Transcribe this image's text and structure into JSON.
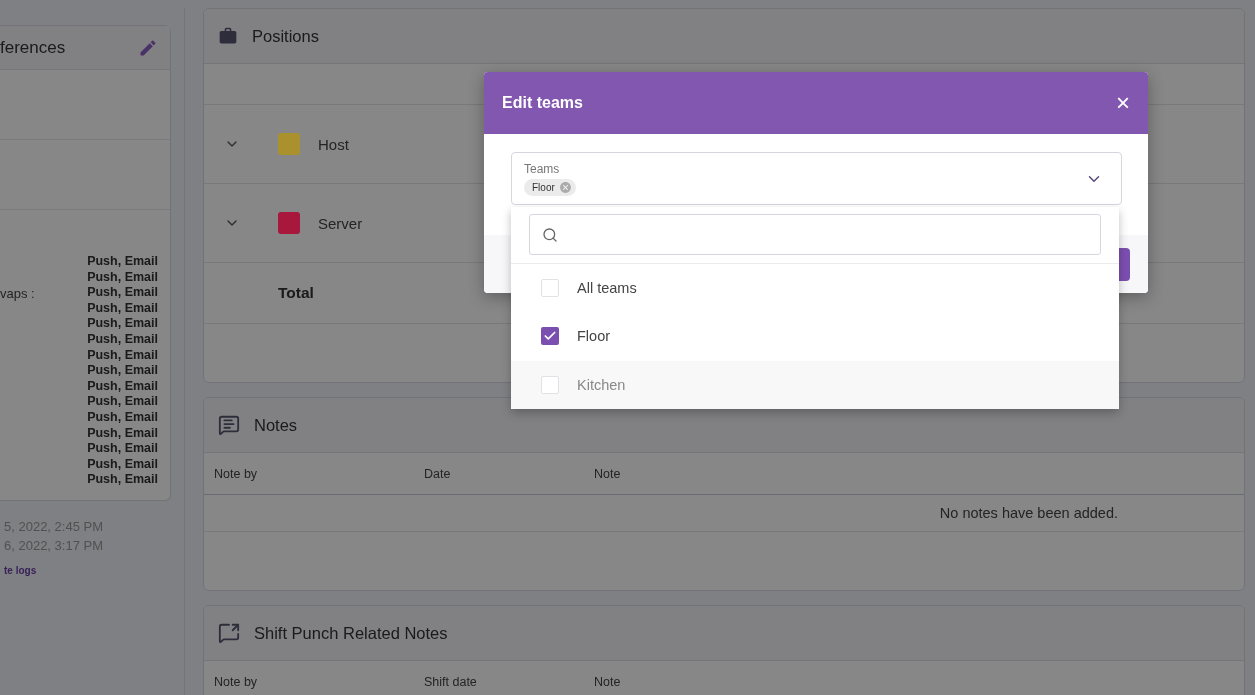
{
  "preferences": {
    "title": "ferences",
    "swap_label": "vaps :",
    "channels": [
      "Push, Email",
      "Push, Email",
      "Push, Email",
      "Push, Email",
      "Push, Email",
      "Push, Email",
      "Push, Email",
      "Push, Email",
      "Push, Email",
      "Push, Email",
      "Push, Email",
      "Push, Email",
      "Push, Email",
      "Push, Email",
      "Push, Email"
    ],
    "dates": [
      "5, 2022, 2:45 PM",
      "6, 2022, 3:17 PM"
    ],
    "link": "te logs"
  },
  "positions": {
    "title": "Positions",
    "rows": [
      {
        "name": "Host",
        "color": "#ab912e"
      },
      {
        "name": "Server",
        "color": "#a8173c"
      }
    ],
    "total_label": "Total"
  },
  "notes": {
    "title": "Notes",
    "columns": [
      "Note by",
      "Date",
      "Note"
    ],
    "empty_text": "No notes have been added."
  },
  "shift_notes": {
    "title": "Shift Punch Related Notes",
    "columns": [
      "Note by",
      "Shift date",
      "Note"
    ]
  },
  "modal": {
    "title": "Edit teams",
    "close": "×",
    "field": {
      "label": "Teams",
      "chips": [
        "Floor"
      ]
    },
    "options": [
      {
        "label": "All teams",
        "checked": false,
        "highlighted": false
      },
      {
        "label": "Floor",
        "checked": true,
        "highlighted": false
      },
      {
        "label": "Kitchen",
        "checked": false,
        "highlighted": true
      }
    ]
  }
}
